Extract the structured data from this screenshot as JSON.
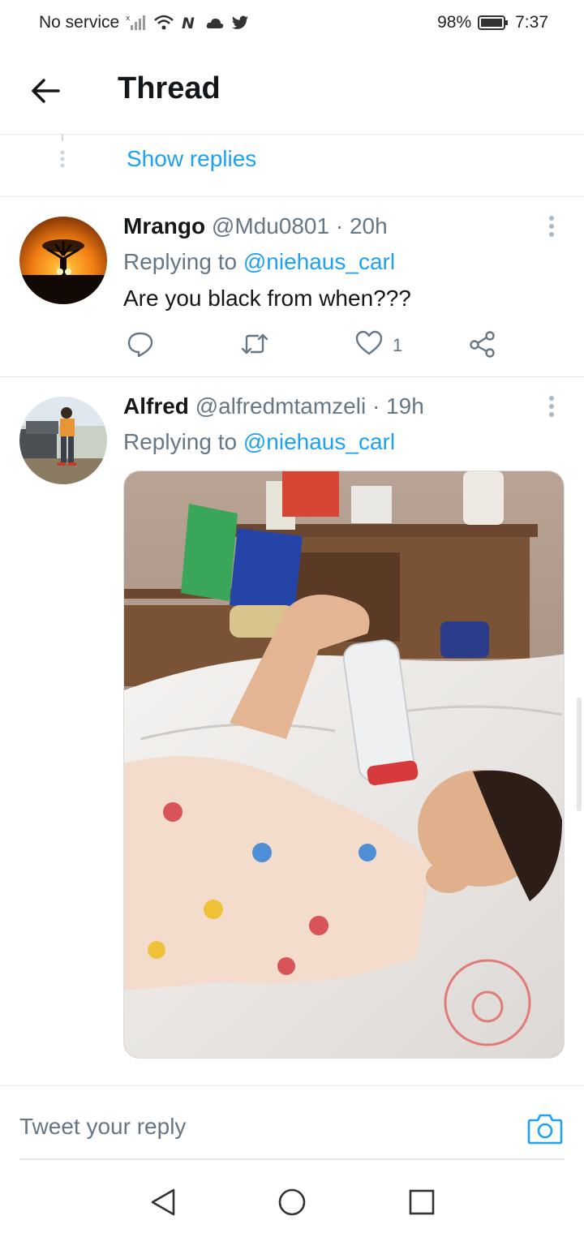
{
  "status_bar": {
    "carrier": "No service",
    "battery": "98%",
    "time": "7:37"
  },
  "header": {
    "title": "Thread"
  },
  "thread": {
    "show_replies": "Show replies"
  },
  "tweets": [
    {
      "name": "Mrango",
      "handle": "@Mdu0801",
      "time": "· 20h",
      "replying_prefix": "Replying to",
      "replying_to": "@niehaus_carl",
      "text": "Are you black from when???",
      "like_count": "1"
    },
    {
      "name": "Alfred",
      "handle": "@alfredmtamzeli",
      "time": "· 19h",
      "replying_prefix": "Replying to",
      "replying_to": "@niehaus_carl"
    }
  ],
  "reply_box": {
    "placeholder": "Tweet your reply"
  },
  "colors": {
    "accent": "#1da1f2",
    "secondary_text": "#657786",
    "divider": "#e1e8ed"
  },
  "icons": {
    "back": "back-arrow-icon",
    "more": "more-vertical-icon",
    "reply": "reply-icon",
    "retweet": "retweet-icon",
    "like": "heart-icon",
    "share": "share-icon",
    "camera": "camera-icon"
  }
}
